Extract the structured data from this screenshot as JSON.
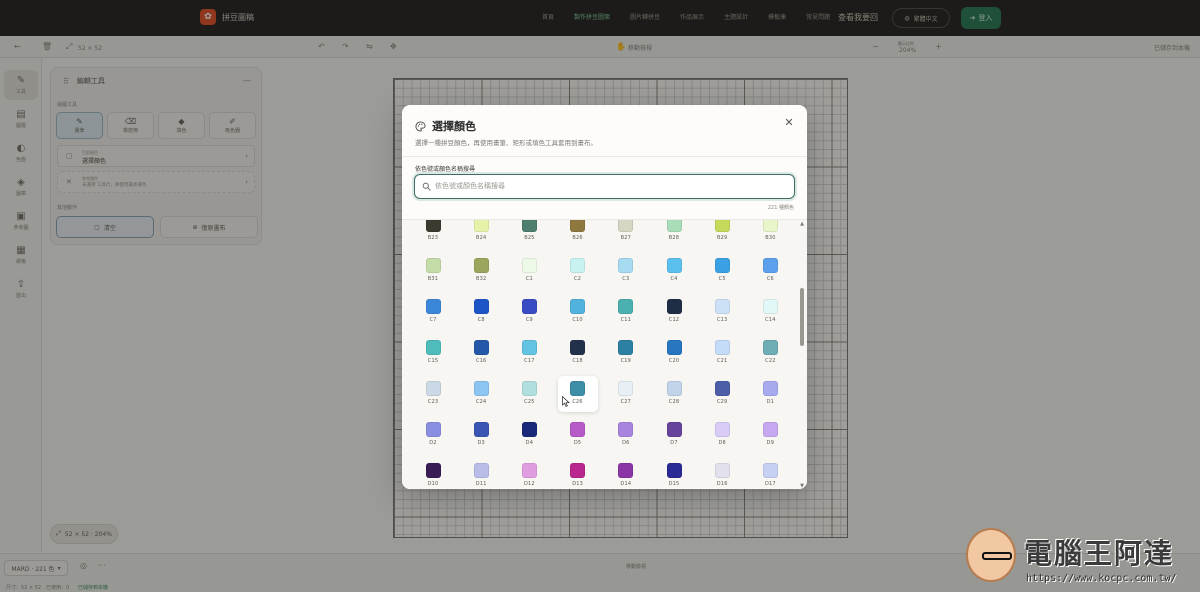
{
  "topnav": {
    "brand": "拼豆圖稿",
    "links": [
      {
        "label": "首頁",
        "active": false
      },
      {
        "label": "製作拼豆圖案",
        "active": true
      },
      {
        "label": "圖片轉拼豆",
        "active": false
      },
      {
        "label": "作品展示",
        "active": false
      },
      {
        "label": "主題設計",
        "active": false
      },
      {
        "label": "模板庫",
        "active": false
      },
      {
        "label": "常見問題",
        "active": false
      }
    ],
    "cta": "查看我要回",
    "language": "繁體中文",
    "login": "登入"
  },
  "toolbar": {
    "size": "52 × 52",
    "mode": "移動檢視",
    "zoom_label": "顯示比例",
    "zoom_value": "204%",
    "saved": "已儲存到本機"
  },
  "rail": [
    {
      "label": "工具",
      "icon": "paint-icon",
      "active": true
    },
    {
      "label": "圖層",
      "icon": "layers-icon",
      "active": false
    },
    {
      "label": "色盤",
      "icon": "palette-icon",
      "active": false
    },
    {
      "label": "圖庫",
      "icon": "stack-icon",
      "active": false
    },
    {
      "label": "參考圖",
      "icon": "image-icon",
      "active": false
    },
    {
      "label": "網格",
      "icon": "grid-icon",
      "active": false
    },
    {
      "label": "匯出",
      "icon": "export-icon",
      "active": false
    }
  ],
  "panel": {
    "title": "編輯工具",
    "section_tools": "繪圖工具",
    "tools": [
      {
        "label": "畫筆",
        "active": true
      },
      {
        "label": "橡皮擦",
        "active": false
      },
      {
        "label": "填色",
        "active": false
      },
      {
        "label": "吸色器",
        "active": false
      }
    ],
    "color_small": "目前顏色",
    "color_main": "選擇顏色",
    "ref_small": "參考顏色",
    "ref_main": "未選擇 工具行，將使用最後選色",
    "section_actions": "其他動作",
    "actions": [
      {
        "label": "清空",
        "primary": true
      },
      {
        "label": "復原畫布",
        "primary": false
      }
    ]
  },
  "zoom_pill": "52 × 52 · 204%",
  "bottombar": {
    "palette": "MARD · 221 色",
    "mode_hint": "移動檢視",
    "status_size": "尺寸：52 × 52",
    "status_beads": "已使用：0",
    "status_save": "已儲存到本機"
  },
  "modal": {
    "title": "選擇顏色",
    "subtitle": "選擇一種拼豆顏色，再使用畫筆、矩形或填色工具套用到畫布。",
    "search_label": "依色號或顏色名稱搜尋",
    "search_placeholder": "依色號或顏色名稱搜尋",
    "search_value": "",
    "count": "221 種顏色",
    "hover_code": "C26",
    "swatches": [
      {
        "code": "B23",
        "color": "#3a3a2e"
      },
      {
        "code": "B24",
        "color": "#e6f2a8"
      },
      {
        "code": "B25",
        "color": "#4e7f6e"
      },
      {
        "code": "B26",
        "color": "#8f7840"
      },
      {
        "code": "B27",
        "color": "#d7d6c4"
      },
      {
        "code": "B28",
        "color": "#a9dcb8"
      },
      {
        "code": "B29",
        "color": "#c5d95a"
      },
      {
        "code": "B30",
        "color": "#e8f5c8"
      },
      {
        "code": "B31",
        "color": "#c6dca8"
      },
      {
        "code": "B32",
        "color": "#9da45c"
      },
      {
        "code": "C1",
        "color": "#eefae8"
      },
      {
        "code": "C2",
        "color": "#c8f2f0"
      },
      {
        "code": "C3",
        "color": "#a6dbf2"
      },
      {
        "code": "C4",
        "color": "#5cc0ee"
      },
      {
        "code": "C5",
        "color": "#3aa2e4"
      },
      {
        "code": "C6",
        "color": "#5da1ec"
      },
      {
        "code": "C7",
        "color": "#3a86d8"
      },
      {
        "code": "C8",
        "color": "#1e55c6"
      },
      {
        "code": "C9",
        "color": "#3a4cc4"
      },
      {
        "code": "C10",
        "color": "#52b2de"
      },
      {
        "code": "C11",
        "color": "#4ab0b0"
      },
      {
        "code": "C12",
        "color": "#1f2d45"
      },
      {
        "code": "C13",
        "color": "#cde1f6"
      },
      {
        "code": "C14",
        "color": "#e2f8f6"
      },
      {
        "code": "C15",
        "color": "#4fbcbc"
      },
      {
        "code": "C16",
        "color": "#2457a8"
      },
      {
        "code": "C17",
        "color": "#62c4e2"
      },
      {
        "code": "C18",
        "color": "#22304a"
      },
      {
        "code": "C19",
        "color": "#2c80a2"
      },
      {
        "code": "C20",
        "color": "#2776c0"
      },
      {
        "code": "C21",
        "color": "#c4dcf8"
      },
      {
        "code": "C22",
        "color": "#6faeb4"
      },
      {
        "code": "C23",
        "color": "#cbd9e6"
      },
      {
        "code": "C24",
        "color": "#8cc4f2"
      },
      {
        "code": "C25",
        "color": "#b1dfe0"
      },
      {
        "code": "C26",
        "color": "#3d8ea6"
      },
      {
        "code": "C27",
        "color": "#e8f0f6"
      },
      {
        "code": "C28",
        "color": "#c2d4ea"
      },
      {
        "code": "C29",
        "color": "#4c5ea8"
      },
      {
        "code": "D1",
        "color": "#a8aaf0"
      },
      {
        "code": "D2",
        "color": "#8a8ee0"
      },
      {
        "code": "D3",
        "color": "#3b55b4"
      },
      {
        "code": "D4",
        "color": "#1a287a"
      },
      {
        "code": "D5",
        "color": "#b65ac8"
      },
      {
        "code": "D6",
        "color": "#a984de"
      },
      {
        "code": "D7",
        "color": "#67439c"
      },
      {
        "code": "D8",
        "color": "#d9ccf6"
      },
      {
        "code": "D9",
        "color": "#c6a8f0"
      },
      {
        "code": "D10",
        "color": "#3a1c54"
      },
      {
        "code": "D11",
        "color": "#b9bde8"
      },
      {
        "code": "D12",
        "color": "#de9ee0"
      },
      {
        "code": "D13",
        "color": "#b8268e"
      },
      {
        "code": "D14",
        "color": "#8a36a6"
      },
      {
        "code": "D15",
        "color": "#2a2a94"
      },
      {
        "code": "D16",
        "color": "#e2e0ec"
      },
      {
        "code": "D17",
        "color": "#c6d0f2"
      }
    ]
  },
  "watermark": {
    "title": "電腦王阿達",
    "url": "https://www.kocpc.com.tw/"
  }
}
